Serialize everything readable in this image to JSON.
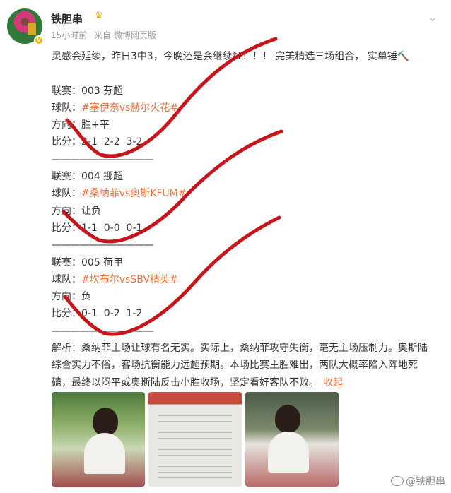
{
  "post": {
    "username": "铁胆串",
    "meta": {
      "time": "15小时前",
      "source": "来自 微博网页版"
    }
  },
  "content": {
    "intro": "灵感会延续，昨日3中3，今晚还是会继续红！！！ 完美精选三场组合， 实单锤🔨",
    "blocks": [
      {
        "league_label": "联赛：",
        "league": "003 芬超",
        "team_label": "球队：",
        "team": "#塞伊奈vs赫尔火花#",
        "dir_label": "方向：",
        "direction": "胜+平",
        "score_label": "比分：",
        "scores": "2-1  2-2  3-2"
      },
      {
        "league_label": "联赛：",
        "league": "004 挪超",
        "team_label": "球队：",
        "team": "#桑纳菲vs奥斯KFUM#",
        "dir_label": "方向：",
        "direction": "让负",
        "score_label": "比分：",
        "scores": "1-1  0-0  0-1"
      },
      {
        "league_label": "联赛：",
        "league": "005 荷甲",
        "team_label": "球队：",
        "team": "#坎布尔vsSBV精英#",
        "dir_label": "方向：",
        "direction": "负",
        "score_label": "比分：",
        "scores": "0-1  0-2  1-2"
      }
    ],
    "divider": "———————————",
    "analysis": "解析：桑纳菲主场让球有名无实。实际上，桑纳菲攻守失衡，毫无主场压制力。奥斯陆综合实力不俗，客场抗衡能力远超预期。本场比赛主胜难出，两队大概率陷入阵地死磕，最终以闷平或奥斯陆反击小胜收场，坚定看好客队不败。",
    "collapse": "收起"
  },
  "watermark": "@铁胆串",
  "colors": {
    "topic": "#eb7340",
    "scribble": "#c8151b",
    "meta": "#999999"
  }
}
